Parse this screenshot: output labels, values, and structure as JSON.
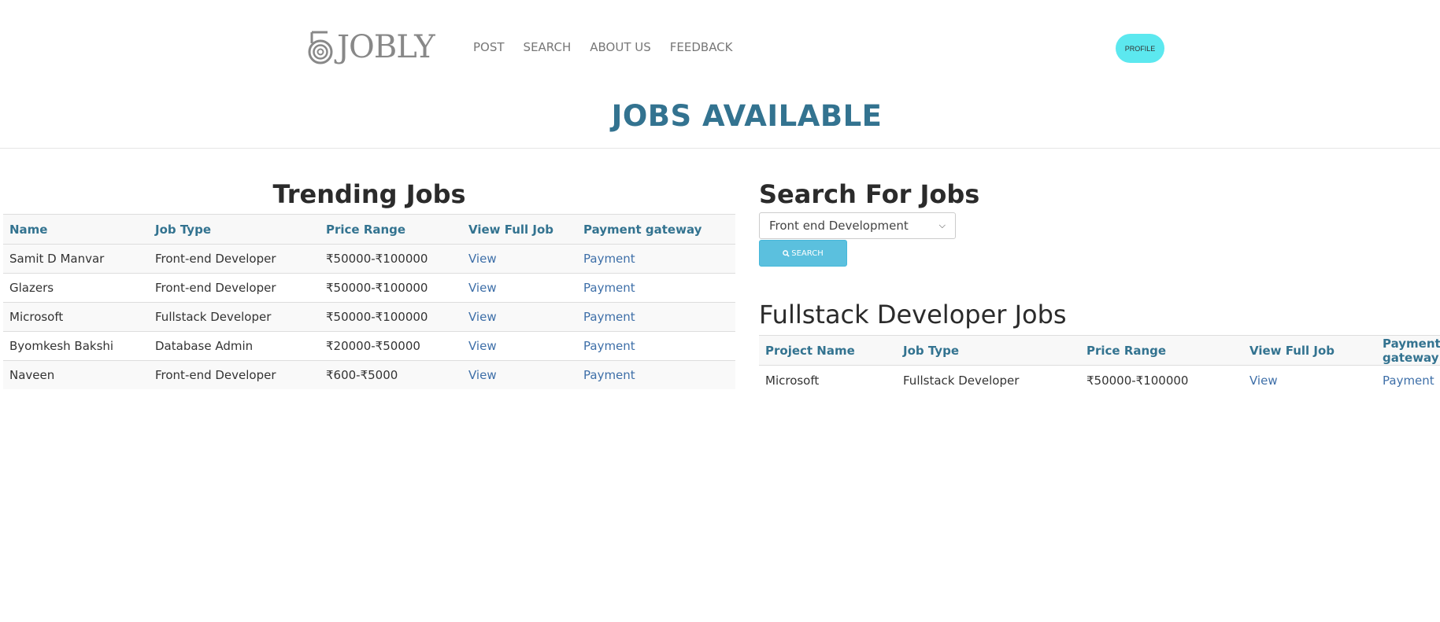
{
  "brand": {
    "name": "JOBLY",
    "logo_icon": "spiral-five-icon",
    "logo_color": "#888888"
  },
  "nav": {
    "items": [
      "POST",
      "SEARCH",
      "ABOUT US",
      "FEEDBACK"
    ]
  },
  "profile": {
    "label": "PROFILE",
    "color": "#5ce8ef"
  },
  "page": {
    "heading": "JOBS AVAILABLE",
    "heading_color": "#337390"
  },
  "trending": {
    "title": "Trending Jobs",
    "columns": [
      "Name",
      "Job Type",
      "Price Range",
      "View Full Job",
      "Payment gateway"
    ],
    "rows": [
      {
        "name": "Samit D Manvar",
        "type": "Front-end Developer",
        "price": "₹50000-₹100000",
        "view": "View",
        "payment": "Payment"
      },
      {
        "name": "Glazers",
        "type": "Front-end Developer",
        "price": "₹50000-₹100000",
        "view": "View",
        "payment": "Payment"
      },
      {
        "name": "Microsoft",
        "type": "Fullstack Developer",
        "price": "₹50000-₹100000",
        "view": "View",
        "payment": "Payment"
      },
      {
        "name": "Byomkesh Bakshi",
        "type": "Database Admin",
        "price": "₹20000-₹50000",
        "view": "View",
        "payment": "Payment"
      },
      {
        "name": "Naveen",
        "type": "Front-end Developer",
        "price": "₹600-₹5000",
        "view": "View",
        "payment": "Payment"
      }
    ]
  },
  "search": {
    "title": "Search For Jobs",
    "selected": "Front end Development",
    "button_label": "SEARCH",
    "button_icon": "search-icon",
    "button_color": "#5bc0de"
  },
  "fullstack": {
    "title": "Fullstack Developer Jobs",
    "columns": [
      "Project Name",
      "Job Type",
      "Price Range",
      "View Full Job",
      "Payment gateway"
    ],
    "rows": [
      {
        "name": "Microsoft",
        "type": "Fullstack Developer",
        "price": "₹50000-₹100000",
        "view": "View",
        "payment": "Payment"
      }
    ]
  }
}
